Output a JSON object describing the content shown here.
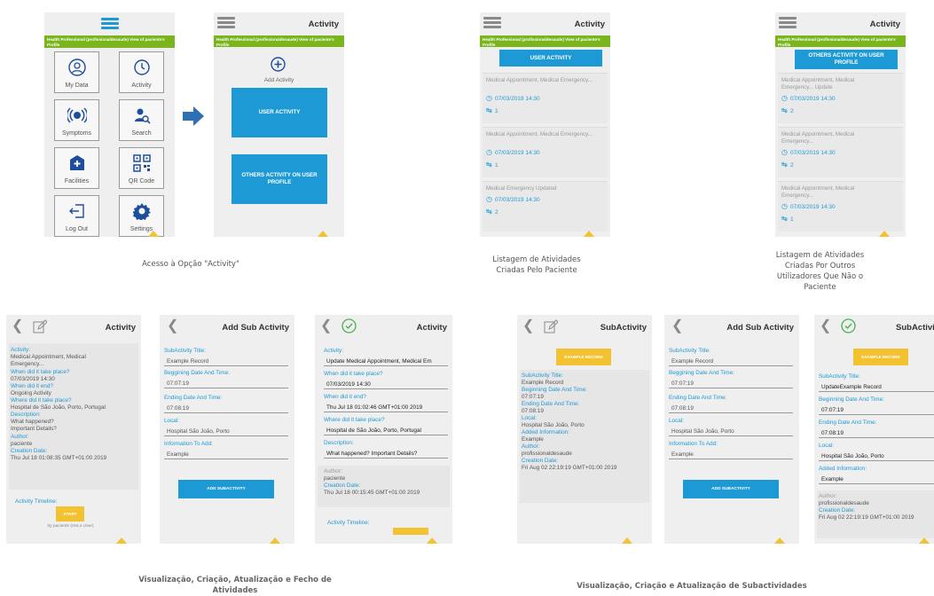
{
  "screen1": {
    "green": "Health Professional (profissionaldesaude) View of paciente's Profile",
    "tiles": [
      "My Data",
      "Activity",
      "Symptoms",
      "Search",
      "Facilities",
      "QR Code",
      "Log Out",
      "Settings"
    ]
  },
  "screen2": {
    "title": "Activity",
    "green": "Health Professional (profissionaldesaude) View of paciente's Profile",
    "add_label": "Add Activity",
    "user_btn": "USER ACTIVITY",
    "others_btn": "OTHERS ACTIVITY ON USER PROFILE"
  },
  "caption1": "Acesso à Opção \"Activity\"",
  "screen3": {
    "title": "Activity",
    "green": "Health Professional (profissionaldesaude) View of paciente's Profile",
    "button": "USER ACTIVITY",
    "cards": [
      {
        "title": "Medical Appointment, Medical Emergency...",
        "date": "07/03/2019 14:30",
        "count": "1"
      },
      {
        "title": "Medical Appointment, Medical Emergency...",
        "date": "07/03/2019 14:30",
        "count": "1"
      },
      {
        "title": "Medical Emergency Updated",
        "date": "07/03/2019 14:30",
        "count": "2"
      }
    ]
  },
  "caption2": "Listagem de Atividades Criadas Pelo Paciente",
  "screen4": {
    "title": "Activity",
    "green": "Health Professional (profissionaldesaude) View of paciente's Profile",
    "button": "OTHERS ACTIVITY ON USER PROFILE",
    "cards": [
      {
        "title": "Medical Appointment, Medical Emergency... Update",
        "date": "07/03/2019 14:30",
        "count": "2"
      },
      {
        "title": "Medical Appointment, Medical Emergency...",
        "date": "07/03/2019 14:30",
        "count": "2"
      },
      {
        "title": "Medical Appointment, Medical Emergency...",
        "date": "07/03/2019 14:30",
        "count": "1"
      }
    ]
  },
  "caption3": "Listagem de Atividades Criadas Por Outros Utilizadores Que Não o Paciente",
  "screen5": {
    "title": "Activity",
    "rows": [
      {
        "k": "Activity:",
        "v": "Medical Appointment, Medical Emergency..."
      },
      {
        "k": "When did it take place?",
        "v": "07/03/2019 14:30"
      },
      {
        "k": "When did it end?",
        "v": "Ongoing Activity"
      },
      {
        "k": "Where did it take place?",
        "v": "Hospital de São João, Porto, Portugal"
      },
      {
        "k": "Description:",
        "v": "What happened? Important Details?"
      },
      {
        "k": "Author:",
        "v": "paciente"
      },
      {
        "k": "Creation Date:",
        "v": "Thu Jul 18 01:08:35 GMT+01:00 2019"
      }
    ],
    "timeline": "Activity Timeline:",
    "start": "START",
    "by": "by paciente (HeLo User)"
  },
  "screen6": {
    "title": "Add Sub Activity",
    "fields": [
      {
        "k": "SubActivity Title:",
        "v": "Example Record"
      },
      {
        "k": "Beggining Date And Time:",
        "v": "07:07:19"
      },
      {
        "k": "Ending Date And Time:",
        "v": "07:08:19"
      },
      {
        "k": "Local:",
        "v": "Hospital São João, Porto"
      },
      {
        "k": "Information To Add:",
        "v": "Example"
      }
    ],
    "button": "ADD SUBACTIVITY"
  },
  "screen7": {
    "title": "Activity",
    "fields": [
      {
        "k": "Activity:",
        "v": "Update Medical Appointment, Medical Em"
      },
      {
        "k": "When did it take place?",
        "v": "07/03/2019 14:30"
      },
      {
        "k": "When did it end?",
        "v": "Thu Jul 18 01:02:46 GMT+01:00 2019"
      },
      {
        "k": "Where did it take place?",
        "v": "Hospital de São João, Porto, Portugal"
      },
      {
        "k": "Description:",
        "v": "What happened?  Important Details?"
      }
    ],
    "author_k": "Author:",
    "author_v": "paciente",
    "date_k": "Creation Date:",
    "date_v": "Thu Jul 18 00:15:45 GMT+01:00 2019",
    "timeline": "Activity Timeline:"
  },
  "caption4": "Visualização, Criação, Atualização e Fecho de Atividades",
  "screen8": {
    "title": "SubActivity",
    "button": "EXAMPLE RECORD",
    "rows": [
      {
        "k": "SubActivity Title:",
        "v": "Example Record"
      },
      {
        "k": "Beginning Date And Time:",
        "v": "07:07:19"
      },
      {
        "k": "Ending Date And Time:",
        "v": "07:08:19"
      },
      {
        "k": "Local:",
        "v": "Hospital São João, Porto"
      },
      {
        "k": "Added Information:",
        "v": "Example"
      },
      {
        "k": "Author:",
        "v": "profissionaldesaude"
      },
      {
        "k": "Creation Date:",
        "v": "Fri Aug 02 22:19:19 GMT+01:00 2019"
      }
    ]
  },
  "screen9": {
    "title": "Add Sub Activity",
    "fields": [
      {
        "k": "SubActivity Title:",
        "v": "Example Record"
      },
      {
        "k": "Beggining Date And Time:",
        "v": "07:07:19"
      },
      {
        "k": "Ending Date And Time:",
        "v": "07:08:19"
      },
      {
        "k": "Local:",
        "v": "Hospital São João, Porto"
      },
      {
        "k": "Information To Add:",
        "v": "Example"
      }
    ],
    "button": "ADD SUBACTIVITY"
  },
  "screen10": {
    "title": "SubActivi",
    "button": "EXAMPLE RECORD",
    "fields": [
      {
        "k": "SubActivity Title:",
        "v": "UpdateExample Record"
      },
      {
        "k": "Beginning Date And Time:",
        "v": "07:07:19"
      },
      {
        "k": "Ending Date And Time:",
        "v": "07:08:19"
      },
      {
        "k": "Local:",
        "v": "Hospital São João, Porto"
      },
      {
        "k": "Added Information:",
        "v": "Example"
      }
    ],
    "author_k": "Author:",
    "author_v": "profissionaldesaude",
    "date_k": "Creation Date:",
    "date_v": "Fri Aug 02 22:19:19 GMT+01:00 2019"
  },
  "caption5": "Visualização, Criação e Atualização de Subactividades",
  "colors": {
    "blue": "#1d9ad6",
    "green": "#7ab51d",
    "yellow": "#f2c230"
  }
}
